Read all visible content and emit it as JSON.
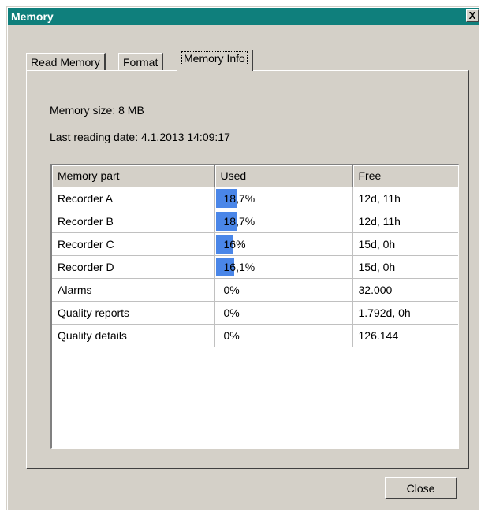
{
  "window": {
    "title": "Memory",
    "close_glyph": "X"
  },
  "tabs": [
    {
      "label": "Read Memory",
      "active": false
    },
    {
      "label": "Format",
      "active": false
    },
    {
      "label": "Memory Info",
      "active": true
    }
  ],
  "info": {
    "memory_size": "Memory size: 8 MB",
    "last_reading": "Last reading date: 4.1.2013 14:09:17"
  },
  "table": {
    "headers": [
      "Memory part",
      "Used",
      "Free"
    ],
    "rows": [
      {
        "part": "Recorder A",
        "used": "18,7%",
        "used_fraction": 0.187,
        "free": "12d, 11h"
      },
      {
        "part": "Recorder B",
        "used": "18,7%",
        "used_fraction": 0.187,
        "free": "12d, 11h"
      },
      {
        "part": "Recorder C",
        "used": "16%",
        "used_fraction": 0.16,
        "free": "15d, 0h"
      },
      {
        "part": "Recorder D",
        "used": "16,1%",
        "used_fraction": 0.161,
        "free": "15d, 0h"
      },
      {
        "part": "Alarms",
        "used": "0%",
        "used_fraction": 0,
        "free": "32.000"
      },
      {
        "part": "Quality reports",
        "used": "0%",
        "used_fraction": 0,
        "free": "1.792d, 0h"
      },
      {
        "part": "Quality details",
        "used": "0%",
        "used_fraction": 0,
        "free": "126.144"
      }
    ]
  },
  "buttons": {
    "close_label": "Close"
  },
  "colors": {
    "titlebar": "#0f7f7c",
    "usage_bar": "#4a86e8",
    "face": "#d4d0c8"
  }
}
